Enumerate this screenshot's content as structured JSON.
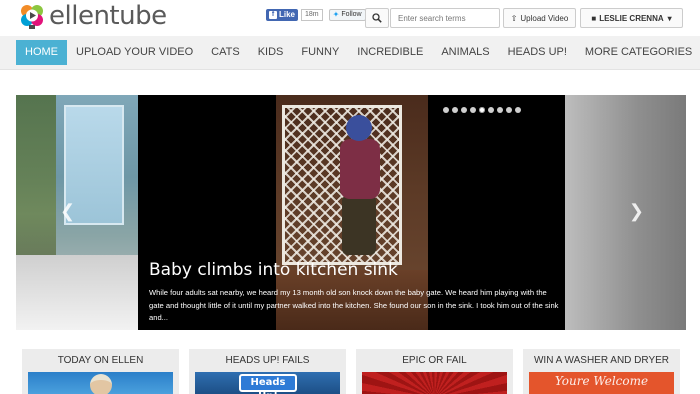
{
  "header": {
    "logo_text": "ellentube",
    "social": {
      "like_label": "Like",
      "like_count": "18m",
      "follow_label": "Follow"
    },
    "search": {
      "placeholder": "Enter search terms"
    },
    "upload_label": "Upload Video",
    "user_label": "LESLIE CRENNA"
  },
  "nav": {
    "items": [
      {
        "label": "HOME",
        "active": true
      },
      {
        "label": "UPLOAD YOUR VIDEO"
      },
      {
        "label": "CATS"
      },
      {
        "label": "KIDS"
      },
      {
        "label": "FUNNY"
      },
      {
        "label": "INCREDIBLE"
      },
      {
        "label": "ANIMALS"
      },
      {
        "label": "HEADS UP!"
      },
      {
        "label": "MORE CATEGORIES"
      }
    ]
  },
  "carousel": {
    "slide_count": 9,
    "active_slide": 5,
    "title": "Baby climbs into kitchen sink",
    "description": "While four adults sat nearby, we heard my 13 month old son knock down the baby gate. We heard him playing with the gate and thought little of it until my partner walked into the kitchen. She found our son in the sink. I took him out of the sink and..."
  },
  "cards": [
    {
      "title": "TODAY ON ELLEN"
    },
    {
      "title": "HEADS UP! FAILS",
      "thumb_text": "Heads Up!"
    },
    {
      "title": "EPIC OR FAIL"
    },
    {
      "title": "WIN A WASHER AND DRYER",
      "thumb_text": "Youre Welcome"
    }
  ],
  "colors": {
    "accent": "#4bb1d3",
    "nav_bg": "#f1f1f1",
    "card_bg": "#ececec"
  }
}
